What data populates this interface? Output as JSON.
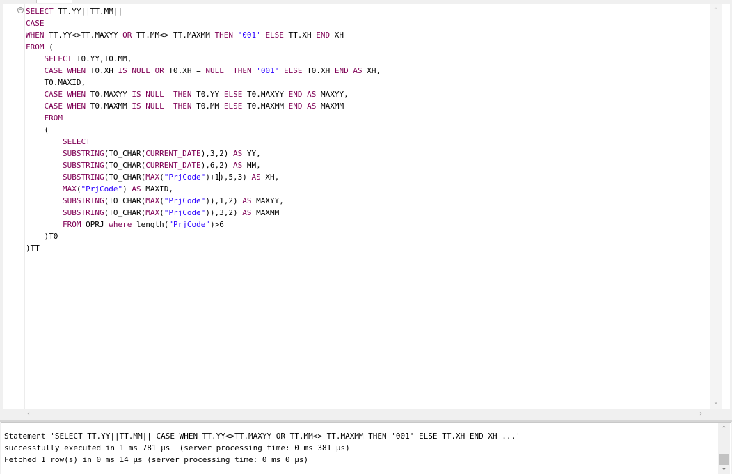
{
  "editor": {
    "lines": [
      [
        {
          "t": "SELECT",
          "c": "k"
        },
        {
          "t": " TT.YY||TT.MM||"
        }
      ],
      [
        {
          "t": "CASE",
          "c": "k"
        }
      ],
      [
        {
          "t": "WHEN",
          "c": "k"
        },
        {
          "t": " TT.YY<>TT.MAXYY "
        },
        {
          "t": "OR",
          "c": "k"
        },
        {
          "t": " TT.MM<> TT.MAXMM "
        },
        {
          "t": "THEN",
          "c": "k"
        },
        {
          "t": " "
        },
        {
          "t": "'001'",
          "c": "s"
        },
        {
          "t": " "
        },
        {
          "t": "ELSE",
          "c": "k"
        },
        {
          "t": " TT.XH "
        },
        {
          "t": "END",
          "c": "k"
        },
        {
          "t": " XH"
        }
      ],
      [
        {
          "t": "FROM",
          "c": "k"
        },
        {
          "t": " ("
        }
      ],
      [
        {
          "t": "    "
        },
        {
          "t": "SELECT",
          "c": "k"
        },
        {
          "t": " T0.YY,T0.MM,"
        }
      ],
      [
        {
          "t": "    "
        },
        {
          "t": "CASE",
          "c": "k"
        },
        {
          "t": " "
        },
        {
          "t": "WHEN",
          "c": "k"
        },
        {
          "t": " T0.XH "
        },
        {
          "t": "IS",
          "c": "k"
        },
        {
          "t": " "
        },
        {
          "t": "NULL",
          "c": "k"
        },
        {
          "t": " "
        },
        {
          "t": "OR",
          "c": "k"
        },
        {
          "t": " T0.XH = "
        },
        {
          "t": "NULL",
          "c": "k"
        },
        {
          "t": "  "
        },
        {
          "t": "THEN",
          "c": "k"
        },
        {
          "t": " "
        },
        {
          "t": "'001'",
          "c": "s"
        },
        {
          "t": " "
        },
        {
          "t": "ELSE",
          "c": "k"
        },
        {
          "t": " T0.XH "
        },
        {
          "t": "END",
          "c": "k"
        },
        {
          "t": " "
        },
        {
          "t": "AS",
          "c": "k"
        },
        {
          "t": " XH,"
        }
      ],
      [
        {
          "t": "    T0.MAXID,"
        }
      ],
      [
        {
          "t": "    "
        },
        {
          "t": "CASE",
          "c": "k"
        },
        {
          "t": " "
        },
        {
          "t": "WHEN",
          "c": "k"
        },
        {
          "t": " T0.MAXYY "
        },
        {
          "t": "IS",
          "c": "k"
        },
        {
          "t": " "
        },
        {
          "t": "NULL",
          "c": "k"
        },
        {
          "t": "  "
        },
        {
          "t": "THEN",
          "c": "k"
        },
        {
          "t": " T0.YY "
        },
        {
          "t": "ELSE",
          "c": "k"
        },
        {
          "t": " T0.MAXYY "
        },
        {
          "t": "END",
          "c": "k"
        },
        {
          "t": " "
        },
        {
          "t": "AS",
          "c": "k"
        },
        {
          "t": " MAXYY,"
        }
      ],
      [
        {
          "t": "    "
        },
        {
          "t": "CASE",
          "c": "k"
        },
        {
          "t": " "
        },
        {
          "t": "WHEN",
          "c": "k"
        },
        {
          "t": " T0.MAXMM "
        },
        {
          "t": "IS",
          "c": "k"
        },
        {
          "t": " "
        },
        {
          "t": "NULL",
          "c": "k"
        },
        {
          "t": "  "
        },
        {
          "t": "THEN",
          "c": "k"
        },
        {
          "t": " T0.MM "
        },
        {
          "t": "ELSE",
          "c": "k"
        },
        {
          "t": " T0.MAXMM "
        },
        {
          "t": "END",
          "c": "k"
        },
        {
          "t": " "
        },
        {
          "t": "AS",
          "c": "k"
        },
        {
          "t": " MAXMM"
        }
      ],
      [
        {
          "t": "    "
        },
        {
          "t": "FROM",
          "c": "k"
        }
      ],
      [
        {
          "t": "    ("
        }
      ],
      [
        {
          "t": "        "
        },
        {
          "t": "SELECT",
          "c": "k"
        }
      ],
      [
        {
          "t": "        "
        },
        {
          "t": "SUBSTRING",
          "c": "k"
        },
        {
          "t": "(TO_CHAR("
        },
        {
          "t": "CURRENT_DATE",
          "c": "k"
        },
        {
          "t": "),3,2) "
        },
        {
          "t": "AS",
          "c": "k"
        },
        {
          "t": " YY,"
        }
      ],
      [
        {
          "t": "        "
        },
        {
          "t": "SUBSTRING",
          "c": "k"
        },
        {
          "t": "(TO_CHAR("
        },
        {
          "t": "CURRENT_DATE",
          "c": "k"
        },
        {
          "t": "),6,2) "
        },
        {
          "t": "AS",
          "c": "k"
        },
        {
          "t": " MM,"
        }
      ],
      [
        {
          "t": "        "
        },
        {
          "t": "SUBSTRING",
          "c": "k"
        },
        {
          "t": "(TO_CHAR("
        },
        {
          "t": "MAX",
          "c": "k"
        },
        {
          "t": "("
        },
        {
          "t": "\"PrjCode\"",
          "c": "s"
        },
        {
          "t": ")+1"
        },
        {
          "t": "",
          "c": "cursor"
        },
        {
          "t": "),5,3) "
        },
        {
          "t": "AS",
          "c": "k"
        },
        {
          "t": " XH,"
        }
      ],
      [
        {
          "t": "        "
        },
        {
          "t": "MAX",
          "c": "k"
        },
        {
          "t": "("
        },
        {
          "t": "\"PrjCode\"",
          "c": "s"
        },
        {
          "t": ") "
        },
        {
          "t": "AS",
          "c": "k"
        },
        {
          "t": " MAXID,"
        }
      ],
      [
        {
          "t": "        "
        },
        {
          "t": "SUBSTRING",
          "c": "k"
        },
        {
          "t": "(TO_CHAR("
        },
        {
          "t": "MAX",
          "c": "k"
        },
        {
          "t": "("
        },
        {
          "t": "\"PrjCode\"",
          "c": "s"
        },
        {
          "t": ")),1,2) "
        },
        {
          "t": "AS",
          "c": "k"
        },
        {
          "t": " MAXYY,"
        }
      ],
      [
        {
          "t": "        "
        },
        {
          "t": "SUBSTRING",
          "c": "k"
        },
        {
          "t": "(TO_CHAR("
        },
        {
          "t": "MAX",
          "c": "k"
        },
        {
          "t": "("
        },
        {
          "t": "\"PrjCode\"",
          "c": "s"
        },
        {
          "t": ")),3,2) "
        },
        {
          "t": "AS",
          "c": "k"
        },
        {
          "t": " MAXMM"
        }
      ],
      [
        {
          "t": "        "
        },
        {
          "t": "FROM",
          "c": "k"
        },
        {
          "t": " OPRJ "
        },
        {
          "t": "where",
          "c": "k"
        },
        {
          "t": " length("
        },
        {
          "t": "\"PrjCode\"",
          "c": "s"
        },
        {
          "t": ")>6"
        }
      ],
      [
        {
          "t": "    )T0"
        }
      ],
      [
        {
          "t": ")TT"
        }
      ]
    ],
    "fold_symbol": "−"
  },
  "console": {
    "lines": [
      "Statement 'SELECT TT.YY||TT.MM|| CASE WHEN TT.YY<>TT.MAXYY OR TT.MM<> TT.MAXMM THEN '001' ELSE TT.XH END XH ...'",
      "successfully executed in 1 ms 781 µs  (server processing time: 0 ms 381 µs)",
      "Fetched 1 row(s) in 0 ms 14 µs (server processing time: 0 ms 0 µs)"
    ]
  },
  "icons": {
    "scroll_up": "chevron-up-icon",
    "scroll_down": "chevron-down-icon",
    "scroll_left": "chevron-left-icon",
    "scroll_right": "chevron-right-icon"
  },
  "colors": {
    "keyword": "#7f0055",
    "string": "#2a00ff",
    "text": "#000000"
  }
}
